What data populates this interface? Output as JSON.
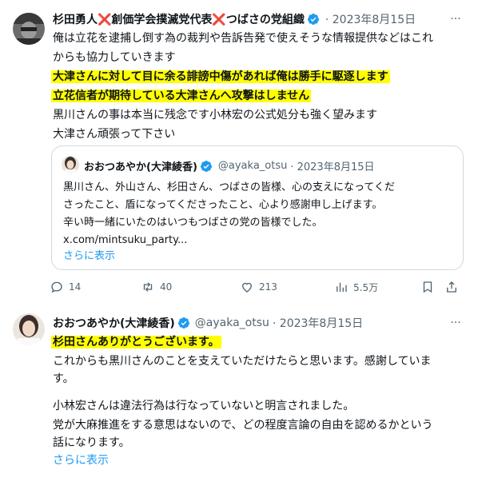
{
  "tweet1": {
    "display_name": "杉田勇人❌創価学会撲滅党代表❌つばさの党組織",
    "date_prefix": "· 2023年8月15日",
    "more_label": "···",
    "lines": [
      "俺は立花を逮捕し倒す為の裁判や告訴告発で使えそうな情報提供などはこれ",
      "からも協力していきます",
      "大津さんに対して目に余る誹謗中傷があれば俺は勝手に駆逐します",
      "立花信者が期待している大津さんへ攻撃はしません",
      "黒川さんの事は本当に残念です小林宏の公式処分も強く望みます",
      "大津さん頑張って下さい"
    ],
    "quote": {
      "display_name": "おおつあやか(大津綾香)",
      "handle": "@ayaka_otsu",
      "date": "· 2023年8月15日",
      "lines": [
        "黒川さん、外山さん、杉田さん、つばさの皆様、心の支えになってくだ",
        "さったこと、盾になってくださったこと、心より感謝申し上げます。",
        "辛い時一緒にいたのはいつもつばさの党の皆様でした。",
        "x.com/mintsuku_party..."
      ],
      "show_more": "さらに表示"
    },
    "actions": {
      "replies": "14",
      "retweets": "40",
      "likes": "213",
      "views": "5.5万"
    }
  },
  "tweet2": {
    "display_name": "おおつあやか(大津綾香)",
    "handle": "@ayaka_otsu",
    "date": "· 2023年8月15日",
    "more_label": "···",
    "lines": [
      "杉田さんありがとうございます。",
      "これからも黒川さんのことを支えていただけたらと思います。感謝していま",
      "す。",
      "小林宏さんは違法行為は行なっていないと明言されました。",
      "党が大麻推進をする意思はないので、どの程度言論の自由を認めるかという",
      "話になります。"
    ],
    "show_more": "さらに表示"
  },
  "colors": {
    "highlight": "#ffff00",
    "verified": "#1d9bf0",
    "link": "#1d9bf0",
    "muted": "#536471"
  }
}
